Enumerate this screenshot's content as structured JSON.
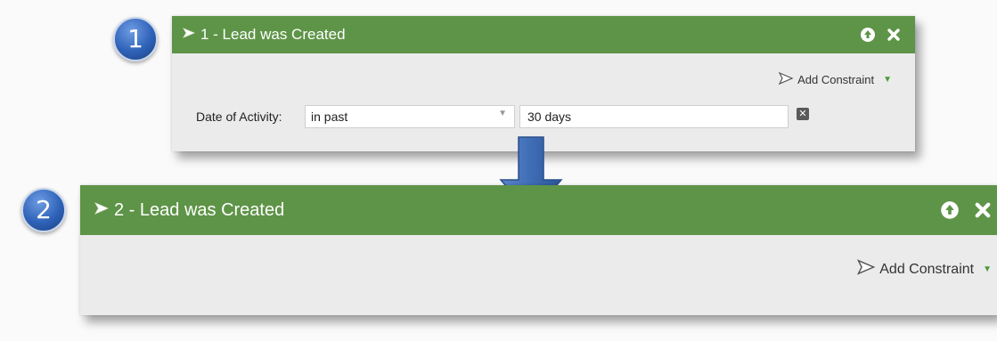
{
  "steps": [
    {
      "badge": "1",
      "title": "1 - Lead was Created",
      "add_constraint_label": "Add Constraint",
      "constraint": {
        "label": "Date of Activity:",
        "operator": "in past",
        "value": "30 days"
      }
    },
    {
      "badge": "2",
      "title": "2 - Lead was Created",
      "add_constraint_label": "Add Constraint"
    }
  ],
  "icons": {
    "header": [
      "flow-step-icon",
      "move-up-icon",
      "close-icon"
    ],
    "constraint": [
      "add-constraint-icon",
      "dropdown-caret-icon",
      "remove-constraint-icon"
    ],
    "transition": "down-arrow-icon"
  },
  "colors": {
    "header_green": "#5e9447",
    "panel_bg": "#ebebeb",
    "badge_blue": "#2e62b8",
    "arrow_blue": "#3f6db5",
    "caret_green": "#4d9a3a"
  }
}
